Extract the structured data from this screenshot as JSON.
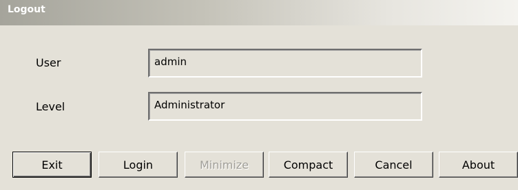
{
  "window": {
    "title": "Logout"
  },
  "fields": {
    "user": {
      "label": "User",
      "value": "admin"
    },
    "level": {
      "label": "Level",
      "value": "Administrator"
    }
  },
  "buttons": {
    "exit": "Exit",
    "login": "Login",
    "minimize": "Minimize",
    "compact": "Compact",
    "cancel": "Cancel",
    "about": "About"
  },
  "colors": {
    "window_background": "#e4e1d8",
    "disabled_text": "#a09e98"
  }
}
